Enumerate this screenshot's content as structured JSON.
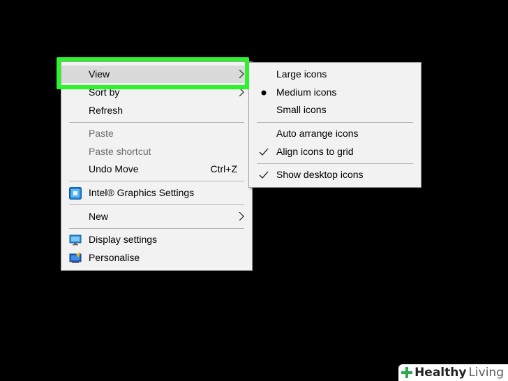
{
  "main_menu": {
    "view": "View",
    "sort_by": "Sort by",
    "refresh": "Refresh",
    "paste": "Paste",
    "paste_shortcut": "Paste shortcut",
    "undo_move": "Undo Move",
    "undo_move_shortcut": "Ctrl+Z",
    "intel_graphics": "Intel® Graphics Settings",
    "new": "New",
    "display_settings": "Display settings",
    "personalise": "Personalise"
  },
  "view_submenu": {
    "large_icons": "Large icons",
    "medium_icons": "Medium icons",
    "small_icons": "Small icons",
    "auto_arrange": "Auto arrange icons",
    "align_to_grid": "Align icons to grid",
    "show_desktop_icons": "Show desktop icons"
  },
  "watermark": {
    "brand_bold": "Healthy",
    "brand_light": "Living"
  },
  "colors": {
    "highlight": "#2ef22e",
    "menu_bg": "#f2f2f2",
    "hover_bg": "#dadada",
    "disabled_text": "#6d6d6d"
  }
}
